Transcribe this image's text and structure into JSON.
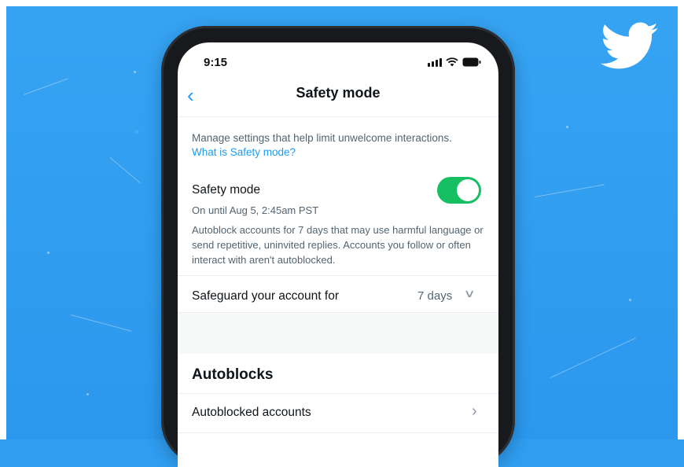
{
  "status_bar": {
    "time": "9:15"
  },
  "nav": {
    "title": "Safety mode"
  },
  "intro": {
    "description": "Manage settings that help limit unwelcome interactions.",
    "link": "What is Safety mode?"
  },
  "safety_mode": {
    "label": "Safety mode",
    "enabled": true,
    "until": "On until Aug 5, 2:45am PST",
    "details": "Autoblock accounts for 7 days that may use harmful language or send repetitive, uninvited replies. Accounts you follow or often interact with aren't autoblocked."
  },
  "safeguard": {
    "label": "Safeguard your account for",
    "value": "7 days"
  },
  "autoblocks": {
    "section_title": "Autoblocks",
    "item_label": "Autoblocked accounts"
  },
  "colors": {
    "background": "#2f9df0",
    "accent": "#1d9bf0",
    "toggle_on": "#17bf63"
  },
  "icons": [
    "twitter-bird-icon",
    "back-chevron-icon",
    "signal-icon",
    "wifi-icon",
    "battery-icon",
    "chevron-down-icon",
    "chevron-right-icon"
  ]
}
